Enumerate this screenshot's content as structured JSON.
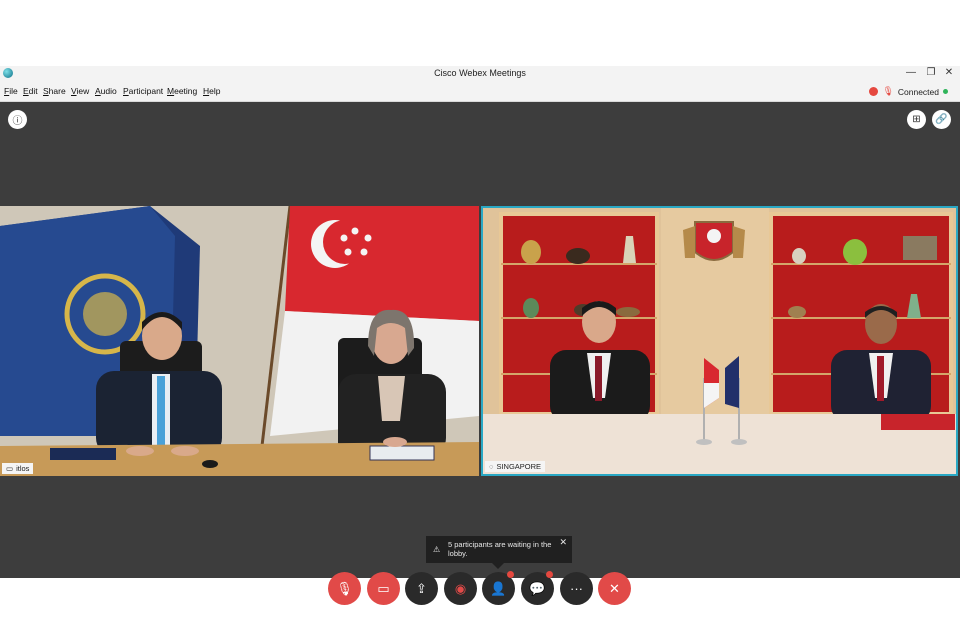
{
  "window": {
    "title": "Cisco Webex Meetings"
  },
  "window_controls": {
    "minimize": "—",
    "restore": "❐",
    "close": "✕"
  },
  "menu": [
    "File",
    "Edit",
    "Share",
    "View",
    "Audio",
    "Participant",
    "Meeting",
    "Help"
  ],
  "status": {
    "connection": "Connected"
  },
  "icons": {
    "info": "ⓘ",
    "layout": "⊞",
    "link": "🔗"
  },
  "tiles": [
    {
      "label": "itlos",
      "label_icon": "▭"
    },
    {
      "label": "SINGAPORE",
      "label_icon": "◌",
      "active_border": "#2aa8c4"
    }
  ],
  "lobby_notice": {
    "text": "5 participants are waiting in the lobby.",
    "icon": "⚠",
    "close": "✕"
  },
  "controls": [
    {
      "name": "mute",
      "icon": "🎙",
      "style": "red"
    },
    {
      "name": "video",
      "icon": "▭",
      "style": "red"
    },
    {
      "name": "share",
      "icon": "⇪",
      "style": "dark"
    },
    {
      "name": "record",
      "icon": "◉",
      "style": "dark"
    },
    {
      "name": "participants",
      "icon": "👤",
      "style": "dark",
      "badge": true
    },
    {
      "name": "chat",
      "icon": "💬",
      "style": "dark",
      "badge": true
    },
    {
      "name": "more",
      "icon": "···",
      "style": "dark"
    },
    {
      "name": "leave",
      "icon": "✕",
      "style": "red"
    }
  ],
  "colors": {
    "red": "#e14a48",
    "dark": "#2a2a2a",
    "stage": "#3d3d3d",
    "connected": "#2fb45a"
  }
}
